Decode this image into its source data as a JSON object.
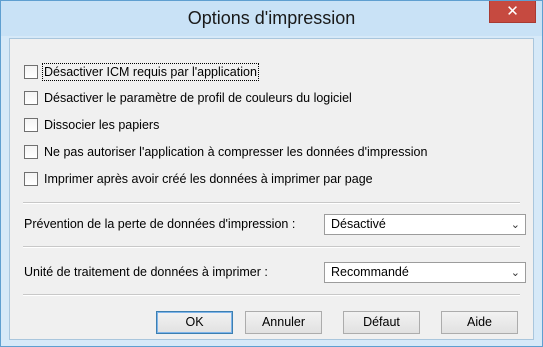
{
  "window": {
    "title": "Options d'impression",
    "close_glyph": "✕"
  },
  "options": [
    {
      "label": "Désactiver ICM requis par l'application",
      "checked": false
    },
    {
      "label": "Désactiver le paramètre de profil de couleurs du logiciel",
      "checked": false
    },
    {
      "label": "Dissocier les papiers",
      "checked": false
    },
    {
      "label": "Ne pas autoriser l'application à compresser les données d'impression",
      "checked": false
    },
    {
      "label": "Imprimer après avoir créé les données à imprimer par page",
      "checked": false
    }
  ],
  "data_loss_prevention": {
    "label": "Prévention de la perte de données d'impression :",
    "value": "Désactivé"
  },
  "processing_unit": {
    "label": "Unité de traitement de données à imprimer :",
    "value": "Recommandé"
  },
  "buttons": {
    "ok": "OK",
    "cancel": "Annuler",
    "default": "Défaut",
    "help": "Aide"
  },
  "colors": {
    "title_bar": "#c9e2f6",
    "close_button": "#c64a40",
    "client_bg": "#f0f0f0"
  }
}
